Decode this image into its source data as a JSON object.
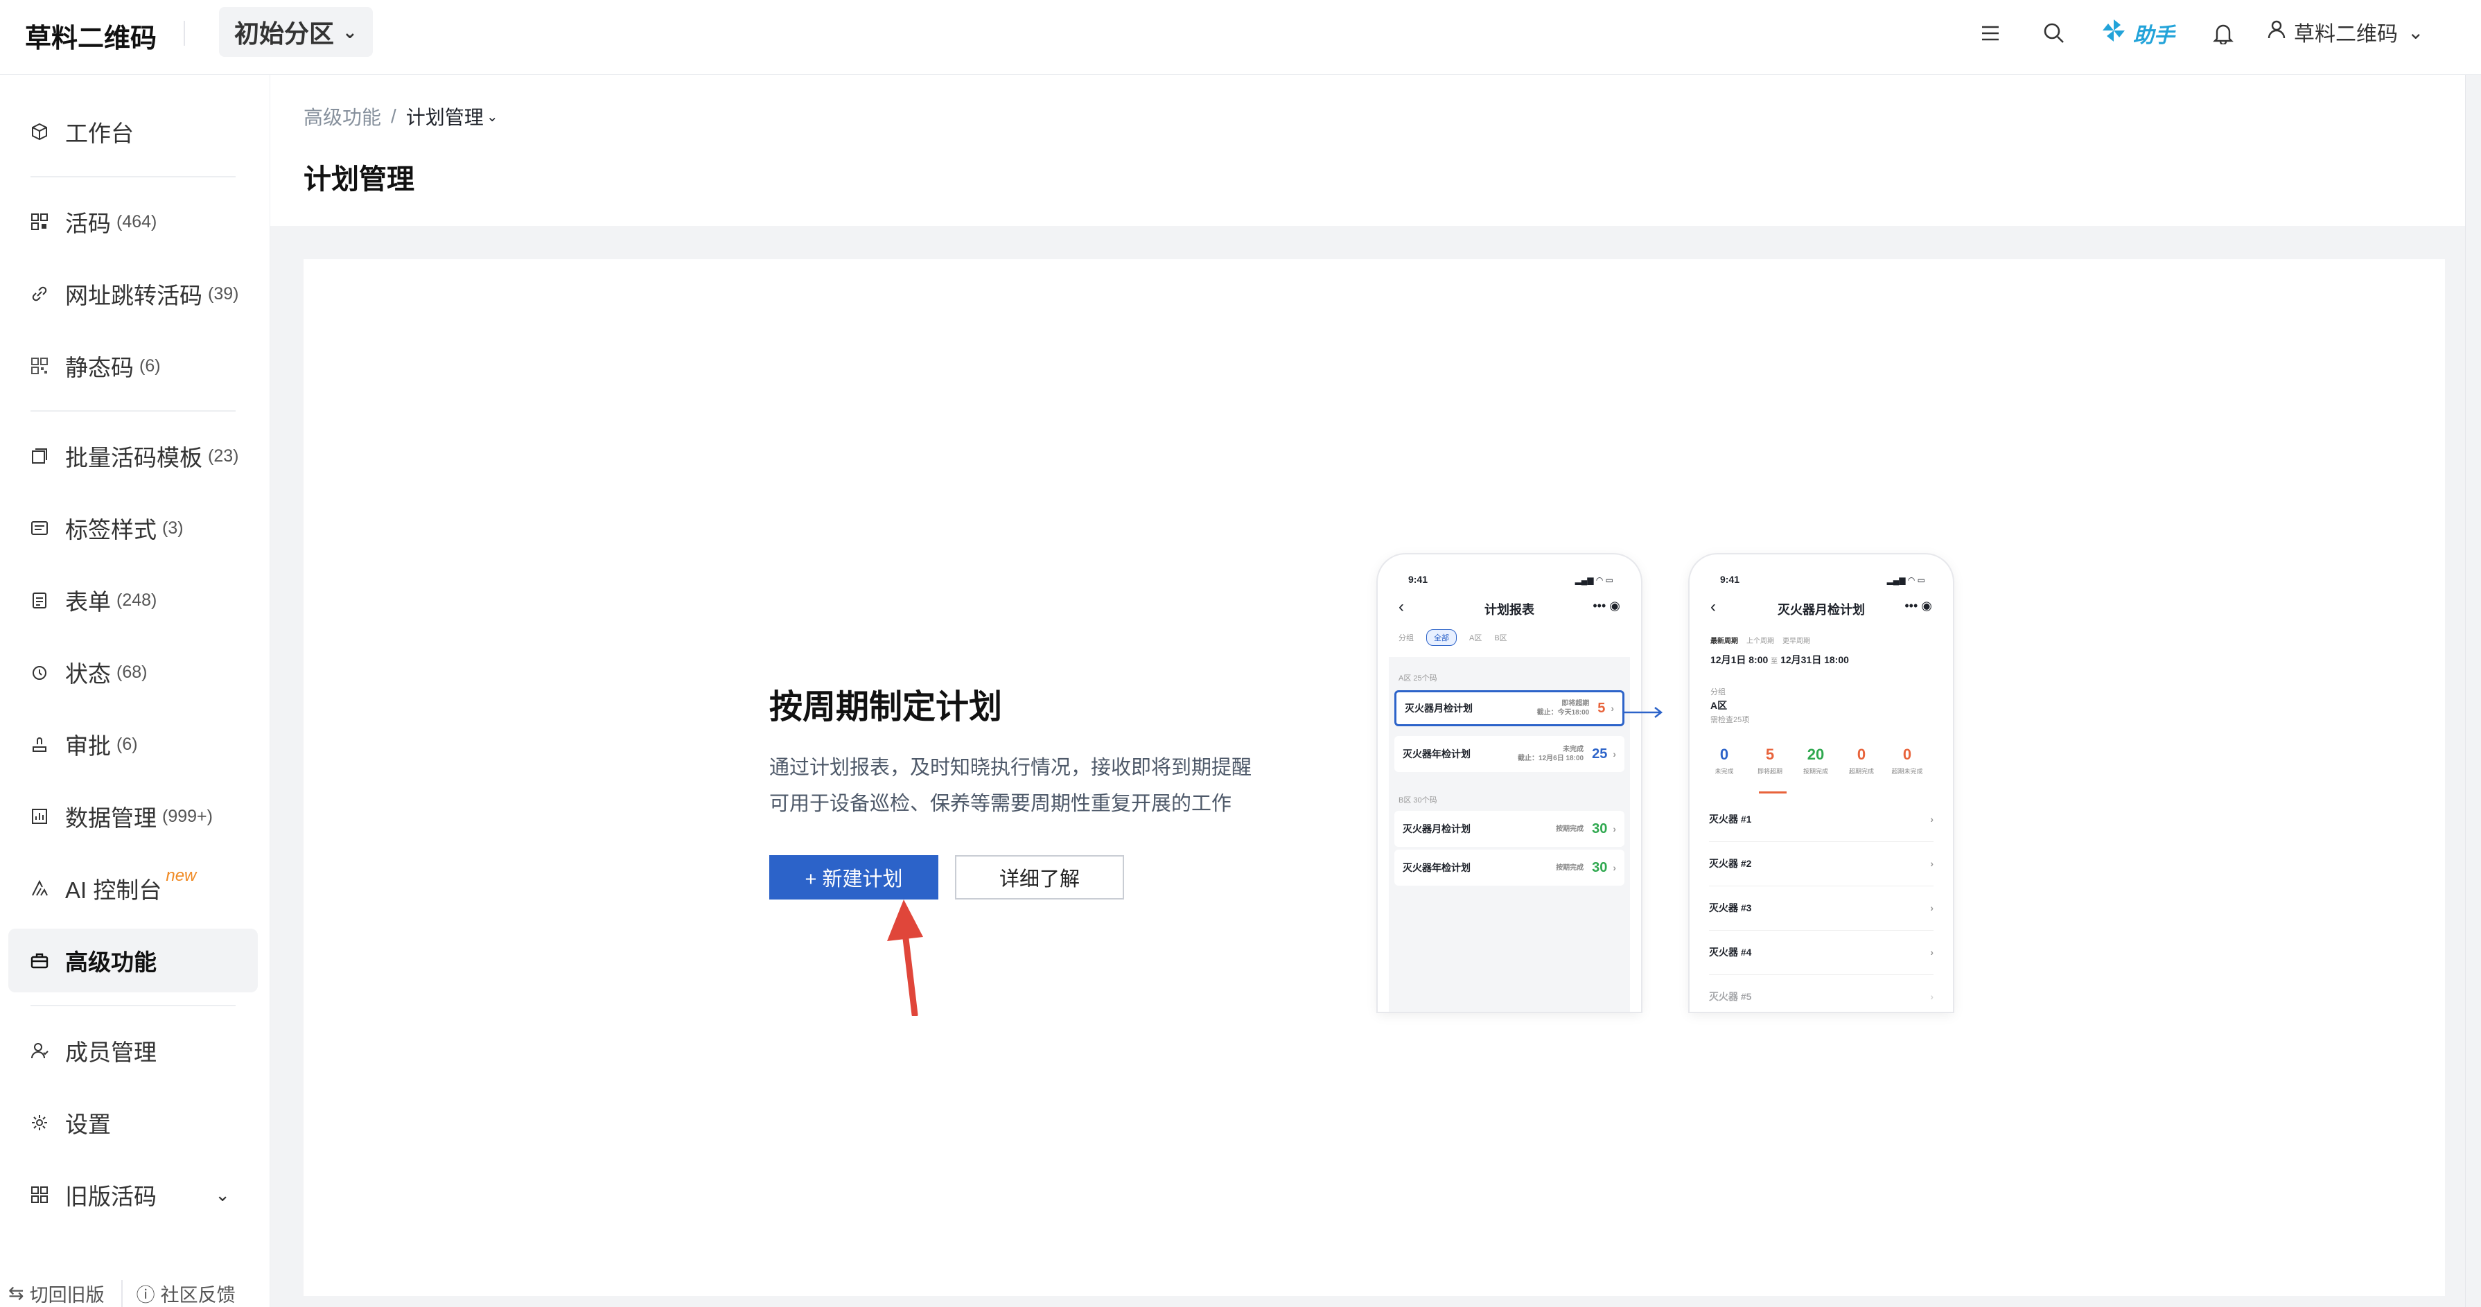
{
  "header": {
    "logo": "草料二维码",
    "space": "初始分区",
    "assistant": "助手",
    "user": "草料二维码"
  },
  "sidebar": {
    "items": [
      {
        "label": "工作台",
        "count": "",
        "icon": "cube-icon"
      },
      {
        "label": "活码",
        "count": "(464)",
        "icon": "qr-grid-icon"
      },
      {
        "label": "网址跳转活码",
        "count": "(39)",
        "icon": "link-icon"
      },
      {
        "label": "静态码",
        "count": "(6)",
        "icon": "static-qr-icon"
      },
      {
        "label": "批量活码模板",
        "count": "(23)",
        "icon": "template-icon"
      },
      {
        "label": "标签样式",
        "count": "(3)",
        "icon": "label-icon"
      },
      {
        "label": "表单",
        "count": "(248)",
        "icon": "form-icon"
      },
      {
        "label": "状态",
        "count": "(68)",
        "icon": "status-icon"
      },
      {
        "label": "审批",
        "count": "(6)",
        "icon": "approval-icon"
      },
      {
        "label": "数据管理",
        "count": "(999+)",
        "icon": "data-icon"
      },
      {
        "label": "AI 控制台",
        "count": "",
        "badge": "new",
        "icon": "ai-icon"
      },
      {
        "label": "高级功能",
        "count": "",
        "icon": "briefcase-icon"
      },
      {
        "label": "成员管理",
        "count": "",
        "icon": "member-icon"
      },
      {
        "label": "设置",
        "count": "",
        "icon": "gear-icon"
      },
      {
        "label": "旧版活码",
        "count": "",
        "icon": "old-qr-icon"
      }
    ],
    "footer": {
      "switch_old": "切回旧版",
      "feedback": "社区反馈"
    }
  },
  "breadcrumb": {
    "parent": "高级功能",
    "sep": "/",
    "current": "计划管理"
  },
  "page": {
    "title": "计划管理"
  },
  "promo": {
    "title": "按周期制定计划",
    "desc_line1": "通过计划报表，及时知晓执行情况，接收即将到期提醒",
    "desc_line2": "可用于设备巡检、保养等需要周期性重复开展的工作",
    "primary": "+ 新建计划",
    "secondary": "详细了解"
  },
  "phone1": {
    "time": "9:41",
    "title": "计划报表",
    "tabs": [
      "分组",
      "全部",
      "A区",
      "B区"
    ],
    "groupA": "A区 25个码",
    "rowA1": {
      "name": "灭火器月检计划",
      "status": "即将超期",
      "sub": "截止：今天18:00",
      "num": "5"
    },
    "rowA2": {
      "name": "灭火器年检计划",
      "status": "未完成",
      "sub": "截止：12月6日 18:00",
      "num": "25"
    },
    "groupB": "B区 30个码",
    "rowB1": {
      "name": "灭火器月检计划",
      "status": "按期完成",
      "num": "30"
    },
    "rowB2": {
      "name": "灭火器年检计划",
      "status": "按期完成",
      "num": "30"
    }
  },
  "phone2": {
    "time": "9:41",
    "title": "灭火器月检计划",
    "tabs": [
      "最新周期",
      "上个周期",
      "更早周期"
    ],
    "period_start": "12月1日 8:00",
    "period_to": "至",
    "period_end": "12月31日 18:00",
    "group_label": "分组",
    "group": "A区",
    "group_sub": "需检查25项",
    "stats": [
      {
        "v": "0",
        "l": "未完成",
        "color": "#2c63c9"
      },
      {
        "v": "5",
        "l": "即将超期",
        "color": "#e8633b"
      },
      {
        "v": "20",
        "l": "按期完成",
        "color": "#2fa84f"
      },
      {
        "v": "0",
        "l": "超期完成",
        "color": "#e8633b"
      },
      {
        "v": "0",
        "l": "超期未完成",
        "color": "#e8633b"
      }
    ],
    "items": [
      "灭火器 #1",
      "灭火器 #2",
      "灭火器 #3",
      "灭火器 #4",
      "灭火器 #5"
    ]
  }
}
